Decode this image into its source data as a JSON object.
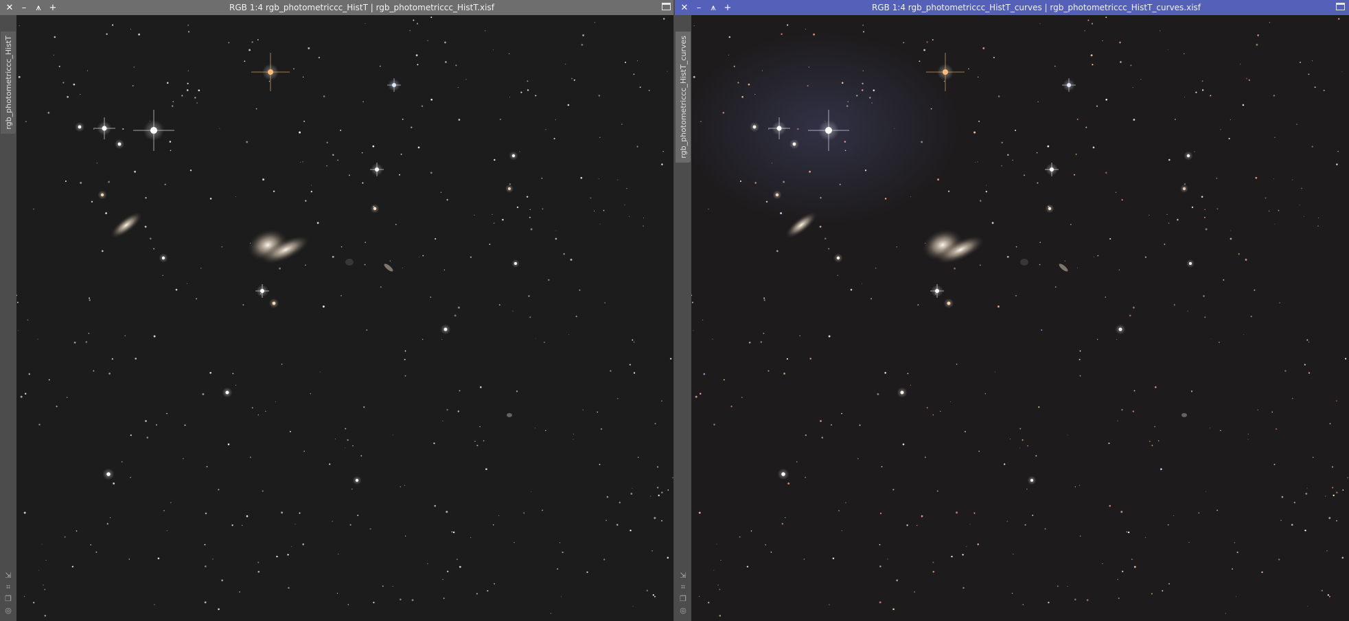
{
  "windows": [
    {
      "title": "RGB 1:4 rgb_photometriccc_HistT | rgb_photometriccc_HistT.xisf",
      "tab_label": "rgb_photometriccc_HistT",
      "buttons": {
        "close": "✕",
        "minimize": "–",
        "shade": "⩚",
        "pin": "+"
      },
      "accent": "#6e6e6e"
    },
    {
      "title": "RGB 1:4 rgb_photometriccc_HistT_curves | rgb_photometriccc_HistT_curves.xisf",
      "tab_label": "rgb_photometriccc_HistT_curves",
      "buttons": {
        "close": "✕",
        "minimize": "–",
        "shade": "⩚",
        "pin": "+"
      },
      "accent": "#5560b8"
    }
  ],
  "icons": [
    "close-icon",
    "minimize-icon",
    "shade-icon",
    "pin-icon",
    "maximize-icon",
    "zoom-fit-icon",
    "crop-icon",
    "clone-icon",
    "settings-icon"
  ]
}
